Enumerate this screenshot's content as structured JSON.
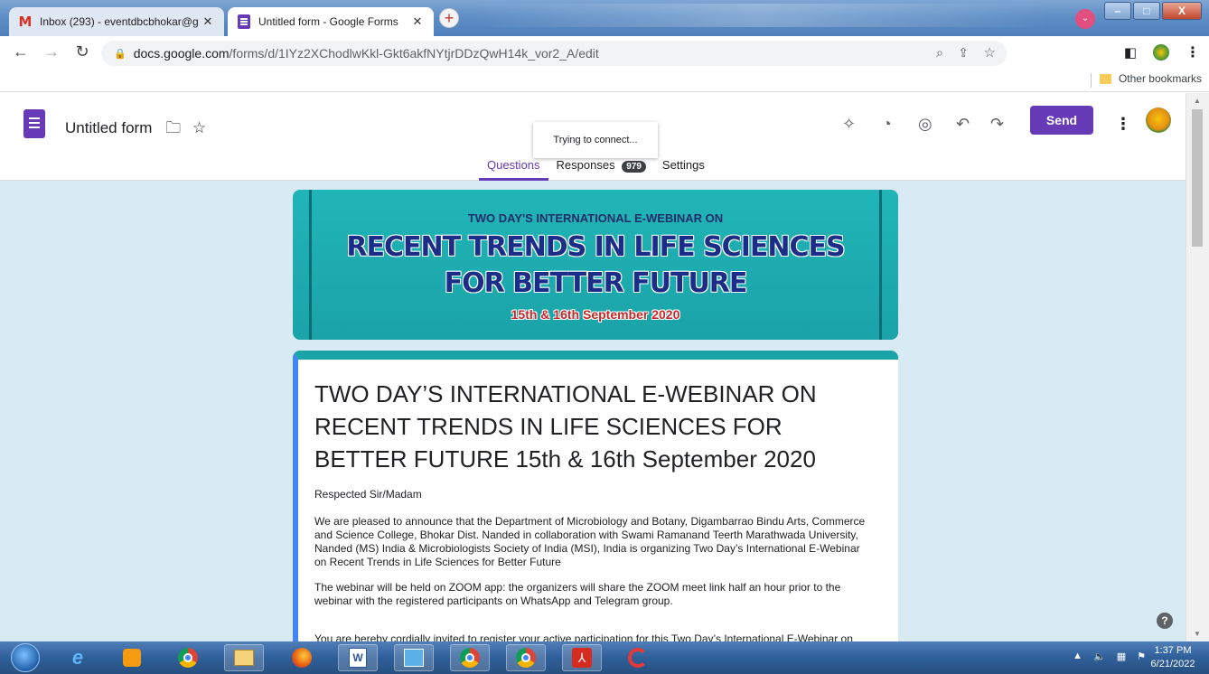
{
  "browser": {
    "tabs": [
      {
        "label": "Inbox (293) - eventdbcbhokar@g",
        "icon": "gmail-icon",
        "active": false
      },
      {
        "label": "Untitled form - Google Forms",
        "icon": "forms-icon",
        "active": true
      }
    ],
    "close_glyph": "✕",
    "new_tab_glyph": "+",
    "profile_glyph": "⌄",
    "window_buttons": {
      "minimize": "–",
      "maximize": "□",
      "close": "X"
    },
    "url_domain": "docs.google.com",
    "url_path": "/forms/d/1IYz2XChodlwKkl-Gkt6akfNYtjrDDzQwH14k_vor2_A/edit",
    "bookmark_folder": "Other bookmarks"
  },
  "forms": {
    "title": "Untitled form",
    "send_label": "Send",
    "toast": "Trying to connect...",
    "tabs": {
      "questions": "Questions",
      "responses": "Responses",
      "responses_count": "979",
      "settings": "Settings"
    }
  },
  "banner": {
    "line1": "TWO DAY'S INTERNATIONAL E-WEBINAR ON",
    "line2": "RECENT TRENDS IN LIFE SCIENCES",
    "line3": "FOR BETTER FUTURE",
    "line4": "15th & 16th September 2020"
  },
  "card": {
    "heading": "TWO DAY’S INTERNATIONAL E-WEBINAR ON RECENT TRENDS IN LIFE SCIENCES FOR BETTER FUTURE 15th & 16th September 2020",
    "greeting": "Respected Sir/Madam",
    "paragraph1": "We are pleased to announce that the Department of Microbiology and Botany, Digambarrao Bindu Arts, Commerce and Science College, Bhokar Dist. Nanded in collaboration with Swami Ramanand Teerth Marathwada University, Nanded (MS) India & Microbiologists Society of India (MSI), India is organizing Two Day’s International E-Webinar on Recent Trends in Life Sciences for Better Future",
    "paragraph2": "The webinar will be held on ZOOM app: the organizers will share the ZOOM meet link half an hour prior to the webinar with the registered participants on WhatsApp and Telegram group.",
    "paragraph3": "You are hereby cordially invited to register your active participation for this Two Day’s International E-Webinar on"
  },
  "help_glyph": "?",
  "taskbar": {
    "time": "1:37 PM",
    "date": "6/21/2022"
  },
  "colors": {
    "accent": "#673ab7",
    "canvas_bg": "#d8ebf5",
    "banner_teal": "#1aa3a8"
  }
}
